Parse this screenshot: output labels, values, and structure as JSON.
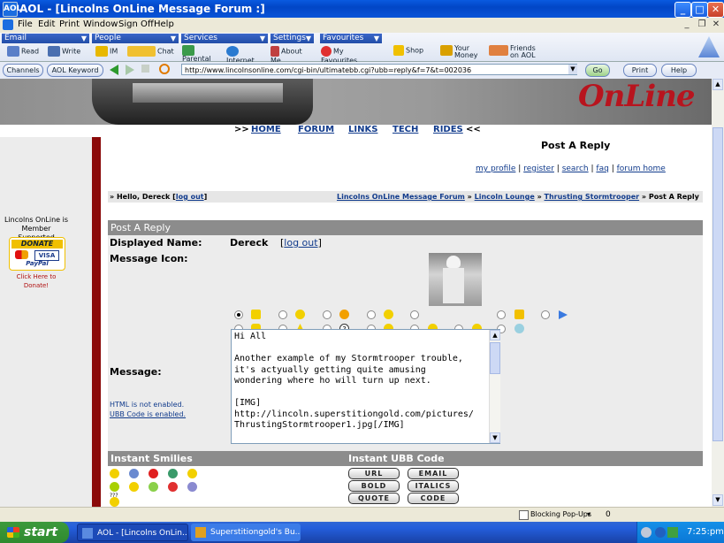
{
  "window": {
    "title": "AOL - [Lincolns OnLine Message Forum :]",
    "app_icon": "AOL",
    "min": "_",
    "max": "□",
    "close": "✕"
  },
  "menu": {
    "items": [
      "File",
      "Edit",
      "Print",
      "Window",
      "Sign Off",
      "Help"
    ]
  },
  "toolbar": {
    "groups": [
      {
        "label": "Email",
        "items": [
          "Read",
          "Write"
        ]
      },
      {
        "label": "People",
        "items": [
          "IM",
          "Chat"
        ]
      },
      {
        "label": "Services",
        "items": [
          "Parental Controls",
          "Internet",
          "About Me"
        ]
      },
      {
        "label": "Settings",
        "items": [
          "My Favourites"
        ]
      },
      {
        "label": "Favourites",
        "items": [
          "Shop",
          "Your Money",
          "Friends on AOL"
        ]
      }
    ],
    "channels": "Channels",
    "keyword": "AOL Keyword",
    "go": "Go",
    "print": "Print",
    "help": "Help",
    "address": "http://www.lincolnsonline.com/cgi-bin/ultimatebb.cgi?ubb=reply&f=7&t=002036"
  },
  "banner": {
    "logo": "OnLine"
  },
  "topnav": {
    "open": ">>",
    "close": "<<",
    "links": [
      "HOME",
      "FORUM",
      "LINKS",
      "TECH",
      "RIDES"
    ]
  },
  "left": {
    "member_text": "Lincolns OnLine is Member Supported",
    "donate": "DONATE",
    "cards": "VISA",
    "paypal": "PayPal",
    "click": "Click Here to Donate!"
  },
  "page": {
    "title": "Post A Reply",
    "links": [
      "my profile",
      "register",
      "search",
      "faq",
      "forum home"
    ],
    "separator": "|",
    "hello": "» Hello, Dereck [",
    "logout": "log out",
    "hello_end": "]",
    "breadcrumb": [
      "Lincolns OnLine Message Forum",
      "Lincoln Lounge",
      "Thrusting Stormtrooper"
    ],
    "breadcrumb_current": "Post A Reply",
    "arrow": "»"
  },
  "form": {
    "header": "Post A Reply",
    "displayed_name_label": "Displayed Name:",
    "displayed_name": "Dereck",
    "logout_open": "[",
    "logout": "log out",
    "logout_close": "]",
    "icon_label": "Message Icon:",
    "message_label": "Message:",
    "html_note": "HTML is not enabled.",
    "ubb_note": "UBB Code is enabled.",
    "message": "Hi All\n\nAnother example of my Stormtrooper trouble,\nit's actyually getting quite amusing\nwondering where ho will turn up next.\n\n[IMG]\nhttp://lincoln.superstitiongold.com/pictures/\nThrustingStormtrooper1.jpg[/IMG]"
  },
  "instant": {
    "smilies_header": "Instant Smilies",
    "ubb_header": "Instant UBB Code",
    "smilies_more": "???",
    "ubb_buttons": [
      "URL",
      "EMAIL",
      "BOLD",
      "ITALICS",
      "QUOTE",
      "CODE"
    ]
  },
  "status": {
    "popups": "Blocking Pop-Ups",
    "popup_arrow": "▾",
    "count": "0"
  },
  "taskbar": {
    "start": "start",
    "items": [
      "AOL - [Lincolns OnLin...",
      "Superstitiongold's Bu..."
    ],
    "time": "7:25:pm"
  },
  "colors": {
    "accent_red": "#8b0a0a",
    "link_blue": "#113b8c",
    "header_gray": "#8c8c8c"
  }
}
